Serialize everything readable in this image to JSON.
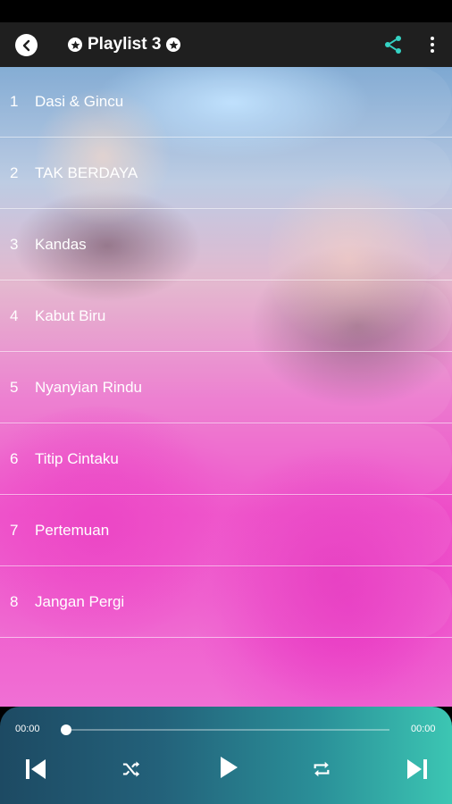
{
  "header": {
    "title": "Playlist 3",
    "back_icon": "chevron-left-icon",
    "share_icon": "share-icon",
    "more_icon": "more-vertical-icon",
    "accent_color": "#35d3c4"
  },
  "tracks": [
    {
      "number": "1",
      "title": "Dasi & Gincu"
    },
    {
      "number": "2",
      "title": "TAK BERDAYA"
    },
    {
      "number": "3",
      "title": "Kandas"
    },
    {
      "number": "4",
      "title": "Kabut Biru"
    },
    {
      "number": "5",
      "title": "Nyanyian Rindu"
    },
    {
      "number": "6",
      "title": "Titip Cintaku"
    },
    {
      "number": "7",
      "title": "Pertemuan"
    },
    {
      "number": "8",
      "title": "Jangan Pergi"
    }
  ],
  "player": {
    "current_time": "00:00",
    "total_time": "00:00",
    "progress": 0,
    "controls": [
      "skip-previous-icon",
      "shuffle-icon",
      "play-icon",
      "repeat-icon",
      "skip-next-icon"
    ]
  }
}
